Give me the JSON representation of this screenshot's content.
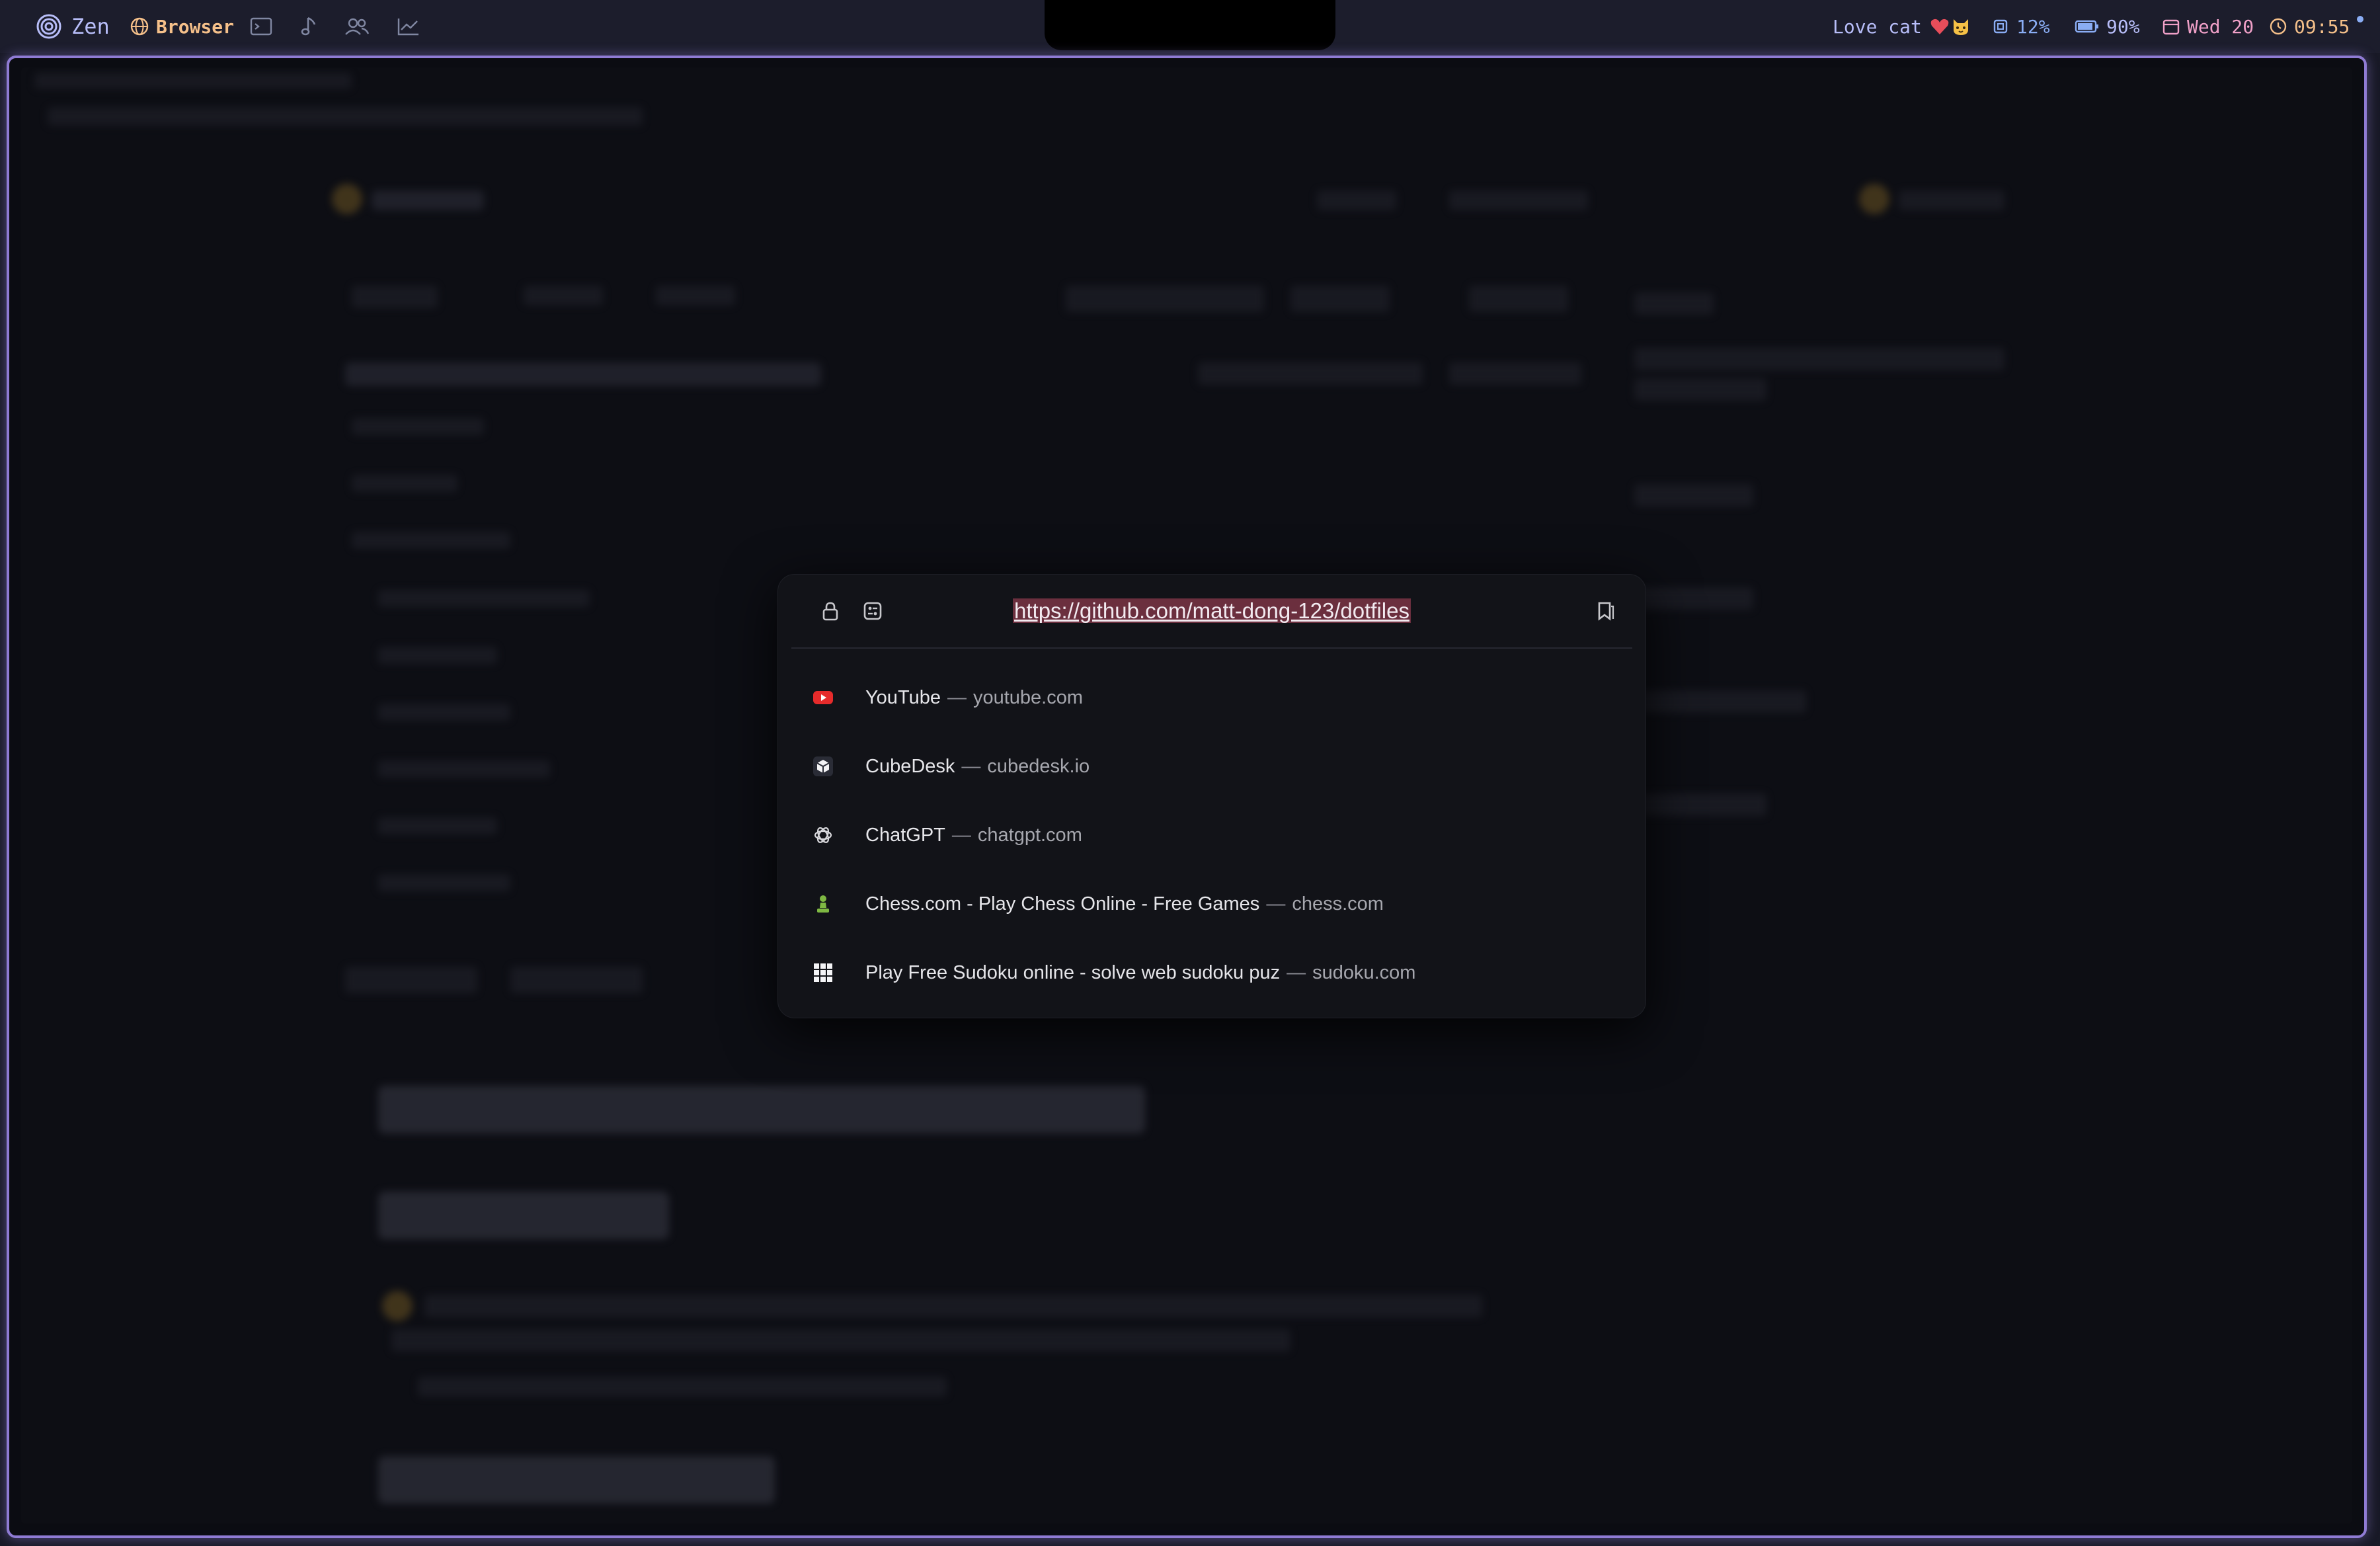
{
  "topbar": {
    "workspace_name": "Zen",
    "app_name": "Browser",
    "status": "Love cat",
    "cpu": "12%",
    "battery": "90%",
    "date": "Wed 20",
    "time": "09:55"
  },
  "colors": {
    "accent": "#b7bdf8",
    "border": "#8f7bd4",
    "highlight": "#6b2f3e",
    "time": "#f5c08a",
    "date": "#f0a0c8"
  },
  "palette": {
    "url": "https://github.com/matt-dong-123/dotfiles",
    "icons": [
      "lock-icon",
      "site-settings-icon",
      "bookmark-icon"
    ],
    "suggestions": [
      {
        "title": "YouTube",
        "domain": "youtube.com",
        "icon": "youtube-icon"
      },
      {
        "title": "CubeDesk",
        "domain": "cubedesk.io",
        "icon": "cubedesk-icon"
      },
      {
        "title": "ChatGPT",
        "domain": "chatgpt.com",
        "icon": "chatgpt-icon"
      },
      {
        "title": "Chess.com - Play Chess Online - Free Games",
        "domain": "chess.com",
        "icon": "chess-pawn-icon"
      },
      {
        "title": "Play Free Sudoku online - solve web sudoku puz",
        "domain": "sudoku.com",
        "icon": "sudoku-grid-icon"
      }
    ]
  }
}
